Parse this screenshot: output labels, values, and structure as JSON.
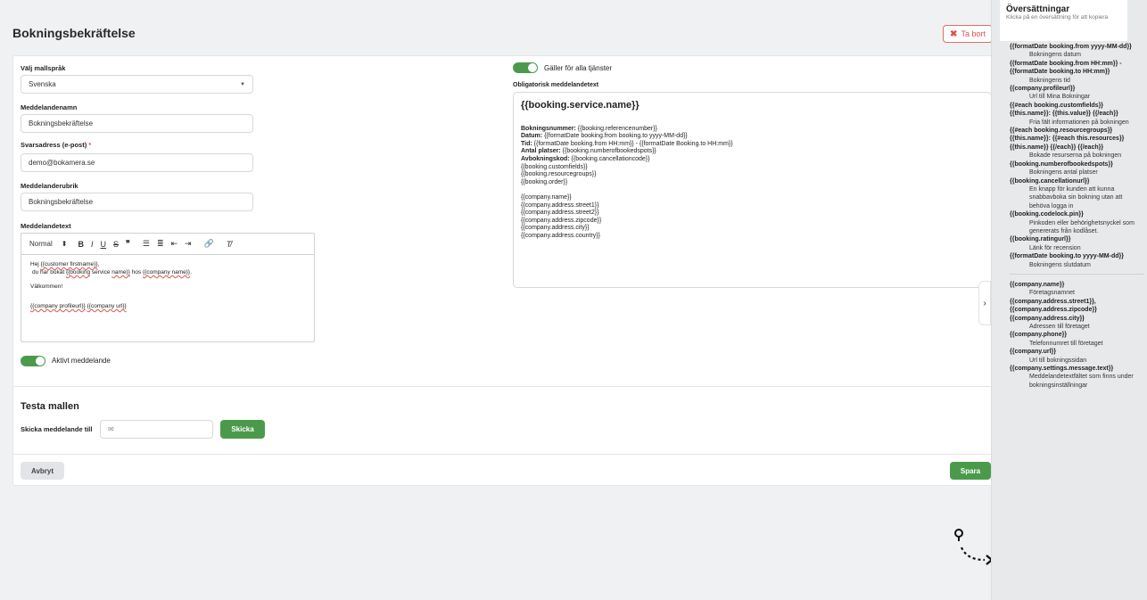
{
  "page": {
    "title": "Bokningsbekräftelse",
    "delete_label": "Ta bort"
  },
  "form": {
    "language_label": "Välj mallspråk",
    "language_value": "Svenska",
    "name_label": "Meddelandenamn",
    "name_value": "Bokningsbekräftelse",
    "reply_label": "Svarsadress (e-post)",
    "reply_required": "*",
    "reply_value": "demo@bokamera.se",
    "subject_label": "Meddelanderubrik",
    "subject_value": "Bokningsbekräftelse",
    "text_label": "Meddelandetext",
    "editor_format": "Normal",
    "editor_format_caret": "⬍",
    "editor_body": {
      "line1a": "Hej ",
      "line1b": "{{customer firstname}}",
      "line1c": ",",
      "line2a": "du har bokat ",
      "line2b": "{{booking",
      "line2c": " service ",
      "line2d": "name}}",
      "line2e": " hos ",
      "line2f": "{{company name}}",
      "line2g": ".",
      "welcome": "Välkommen!",
      "profile": "{{company profileurl}}",
      "url": "{{company url}}"
    },
    "active_label": "Aktivt meddelande"
  },
  "right": {
    "all_services_label": "Gäller för alla tjänster",
    "mandatory_label": "Obligatorisk meddelandetext",
    "template_title": "{{booking.service.name}}",
    "lines": [
      {
        "b": "Bokningsnummer:",
        "t": " {{booking.referencenumber}}"
      },
      {
        "b": "Datum:",
        "t": " {{formatDate booking.from booking.to yyyy-MM-dd}}"
      },
      {
        "b": "Tid:",
        "t": " {{formatDate booking.from HH:mm}} - {{formatDate Booking.to HH:mm}}"
      },
      {
        "b": "Antal platser:",
        "t": " {{booking.numberofbookedspots}}"
      },
      {
        "b": "Avbokningskod:",
        "t": " {{booking.cancellationcode}}"
      },
      {
        "b": "",
        "t": "{{booking.customfields}}"
      },
      {
        "b": "",
        "t": "{{booking.resourcegroups}}"
      },
      {
        "b": "",
        "t": "{{booking.order}}"
      }
    ],
    "company_lines": [
      "{{company.name}}",
      "{{company.address.street1}}",
      "{{company.address.street2}}",
      "{{company.address.zipcode}}",
      "{{company.address.city}}",
      "{{company.address.country}}"
    ]
  },
  "test": {
    "title": "Testa mallen",
    "send_to_label": "Skicka meddelande till",
    "send_label": "Skicka"
  },
  "footer": {
    "cancel_label": "Avbryt",
    "save_label": "Spara"
  },
  "sidebar": {
    "title": "Översättningar",
    "subtitle": "Klicka på en översättning för att kopiera",
    "items": [
      {
        "ph": "{{formatDate booking.from yyyy-MM-dd}}",
        "desc": "Bokningens datum"
      },
      {
        "ph": "{{formatDate booking.from HH:mm}} - {{formatDate booking.to HH:mm}}",
        "desc": "Bokningens tid"
      },
      {
        "ph": "{{company.profileurl}}",
        "desc": "Url till Mina Bokningar"
      },
      {
        "ph": "{{#each booking.customfields}} {{this.name}}: {{this.value}} {{/each}}",
        "desc": "Fria fält informationen på bokningen"
      },
      {
        "ph": "{{#each booking.resourcegroups}} {{this.name}}: {{#each this.resources}} {{this.name}} {{/each}} {{/each}}",
        "desc": "Bokade resurserna på bokningen"
      },
      {
        "ph": "{{booking.numberofbookedspots}}",
        "desc": "Bokningens antal platser"
      },
      {
        "ph": "{{booking.cancellationurl}}",
        "desc": "En knapp för kunden att kunna snabbavboka sin bokning utan att behöva logga in"
      },
      {
        "ph": "{{booking.codelock.pin}}",
        "desc": "Pinkoden eller behörighetsnyckel som genererats från kodlåset."
      },
      {
        "ph": "{{booking.ratingurl}}",
        "desc": "Länk för recension"
      },
      {
        "ph": "{{formatDate booking.to yyyy-MM-dd}}",
        "desc": "Bokningens slutdatum"
      }
    ],
    "company_items": [
      {
        "ph": "{{company.name}}",
        "desc": "Företagsnamnet"
      },
      {
        "ph": "{{company.address.street1}}, {{company.address.zipcode}} {{company.address.city}}",
        "desc": "Adressen till företaget"
      },
      {
        "ph": "{{company.phone}}",
        "desc": "Telefonnumret till företaget"
      },
      {
        "ph": "{{company.url}}",
        "desc": "Url till bokningssidan"
      },
      {
        "ph": "{{company.settings.message.text}}",
        "desc": "Meddelandetextfältet som finns under bokningsinställningar"
      }
    ]
  },
  "colors": {
    "accent": "#4b9a4b",
    "danger": "#d9534f"
  }
}
